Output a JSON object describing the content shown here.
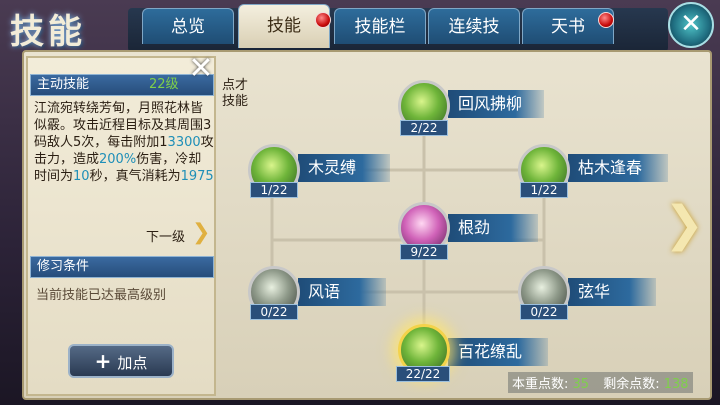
{
  "title": "技能",
  "tabs": [
    {
      "label": "总览",
      "active": false,
      "alert": false
    },
    {
      "label": "技能",
      "active": true,
      "alert": true
    },
    {
      "label": "技能栏",
      "active": false,
      "alert": false
    },
    {
      "label": "连续技",
      "active": false,
      "alert": false
    },
    {
      "label": "天书",
      "active": false,
      "alert": true
    }
  ],
  "close_symbol": "✕",
  "info": {
    "header_label": "主动技能",
    "header_level": "22级",
    "desc_a": "江流宛转绕芳甸，月照花林皆似霰。攻击近程目标及其周围3码敌人5次，每击附加1",
    "desc_b": "3300",
    "desc_c": "攻击力，造成",
    "desc_d": "200%",
    "desc_e": "伤害，冷却时间为",
    "desc_f": "10",
    "desc_g": "秒，真气消耗为",
    "desc_h": "1975",
    "next_level": "下一级",
    "cond_header": "修习条件",
    "cond_text": "当前技能已达最高级别",
    "add_button": "加点"
  },
  "partial_text_1": "点才",
  "partial_text_2": "技能",
  "skills": [
    {
      "name": "回风拂柳",
      "level": "2/22",
      "color": "green"
    },
    {
      "name": "木灵缚",
      "level": "1/22",
      "color": "green"
    },
    {
      "name": "枯木逢春",
      "level": "1/22",
      "color": "green"
    },
    {
      "name": "根劲",
      "level": "9/22",
      "color": "pink"
    },
    {
      "name": "风语",
      "level": "0/22",
      "color": "grey"
    },
    {
      "name": "弦华",
      "level": "0/22",
      "color": "grey"
    },
    {
      "name": "百花缭乱",
      "level": "22/22",
      "color": "green"
    }
  ],
  "points": {
    "current_label": "本重点数:",
    "current_value": "35",
    "remaining_label": "剩余点数:",
    "remaining_value": "138"
  },
  "colors": {
    "accent": "#2d6a9e",
    "highlight": "#1f8fb8",
    "points": "#7fd04a"
  }
}
